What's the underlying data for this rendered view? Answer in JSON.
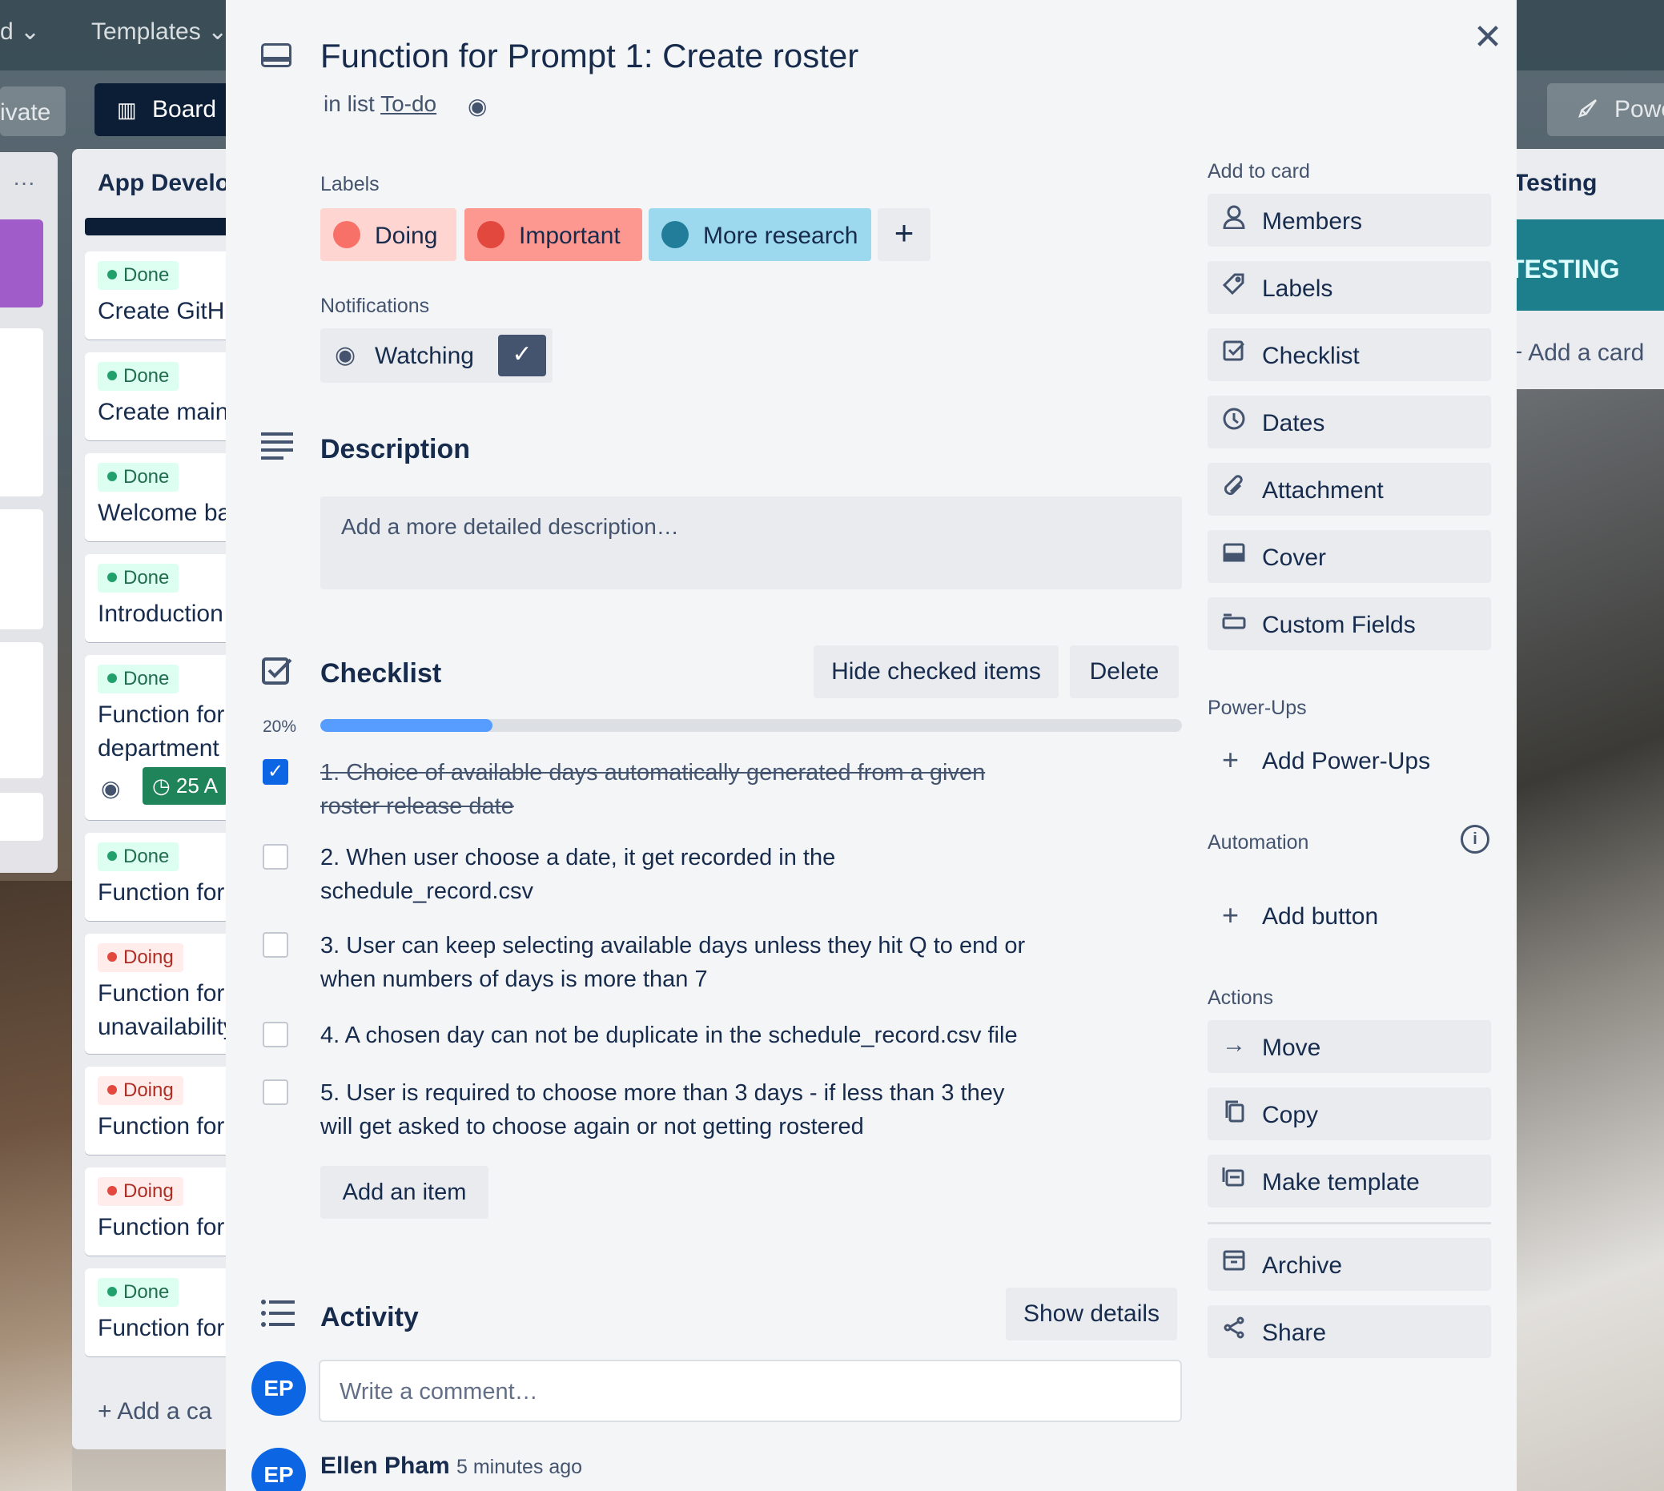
{
  "background": {
    "topbar": {
      "view_switch_fragment": "d",
      "templates": "Templates"
    },
    "subbar": {
      "private": "ivate",
      "board": "Board",
      "power_ups": "Powe"
    },
    "left_list": {
      "title": "App Develop",
      "cards": [
        {
          "badge": "Done",
          "text": "Create GitHu"
        },
        {
          "badge": "Done",
          "text": "Create main."
        },
        {
          "badge": "Done",
          "text": "Welcome ba"
        },
        {
          "badge": "Done",
          "text": "Introduction"
        },
        {
          "badge": "Done",
          "text": "Function for",
          "text2": "department",
          "date": "25 A"
        },
        {
          "badge": "Done",
          "text": "Function for"
        },
        {
          "badge": "Doing",
          "text": "Function for",
          "text2": "unavailability"
        },
        {
          "badge": "Doing",
          "text": "Function for"
        },
        {
          "badge": "Doing",
          "text": "Function for"
        },
        {
          "badge": "Done",
          "text": "Function for"
        }
      ],
      "add_card": "Add a ca"
    },
    "right_list": {
      "title": "Testing",
      "cover": "TESTING",
      "add_card": "Add a card"
    }
  },
  "card": {
    "title": "Function for Prompt 1: Create roster",
    "in_list_prefix": "in list",
    "list_name": "To-do"
  },
  "labels": {
    "heading": "Labels",
    "items": [
      {
        "name": "Doing",
        "bg": "#ffd5d2",
        "dot": "#f87168"
      },
      {
        "name": "Important",
        "bg": "#fd9891",
        "dot": "#e2483d"
      },
      {
        "name": "More research",
        "bg": "#9dd9ee",
        "dot": "#227d9b"
      }
    ],
    "add": "+"
  },
  "notifications": {
    "heading": "Notifications",
    "watching": "Watching"
  },
  "description": {
    "heading": "Description",
    "placeholder": "Add a more detailed description…"
  },
  "checklist": {
    "heading": "Checklist",
    "hide_checked": "Hide checked items",
    "delete": "Delete",
    "percent_label": "20%",
    "progress": 0.2,
    "items": [
      {
        "text": "1. Choice of available days automatically generated from a given roster release date",
        "checked": true
      },
      {
        "text": "2. When user choose a date, it get recorded in the schedule_record.csv",
        "checked": false
      },
      {
        "text": "3. User can keep selecting available days unless they hit Q to end or when numbers of days is more than 7",
        "checked": false
      },
      {
        "text": "4. A chosen day can not be duplicate in the schedule_record.csv file",
        "checked": false
      },
      {
        "text": "5. User is required to choose more than 3 days - if less than 3 they will get asked to choose again or not getting rostered",
        "checked": false
      }
    ],
    "add_item": "Add an item"
  },
  "activity": {
    "heading": "Activity",
    "show_details": "Show details",
    "comment_placeholder": "Write a comment…",
    "avatar_initials": "EP",
    "entries": [
      {
        "user": "Ellen Pham",
        "time": "5 minutes ago",
        "initials": "EP"
      }
    ]
  },
  "sidebar": {
    "add_to_card": {
      "heading": "Add to card",
      "items": [
        "Members",
        "Labels",
        "Checklist",
        "Dates",
        "Attachment",
        "Cover",
        "Custom Fields"
      ]
    },
    "power_ups": {
      "heading": "Power-Ups",
      "add": "Add Power-Ups"
    },
    "automation": {
      "heading": "Automation",
      "add_button": "Add button"
    },
    "actions": {
      "heading": "Actions",
      "items": [
        "Move",
        "Copy",
        "Make template",
        "Archive",
        "Share"
      ]
    }
  }
}
